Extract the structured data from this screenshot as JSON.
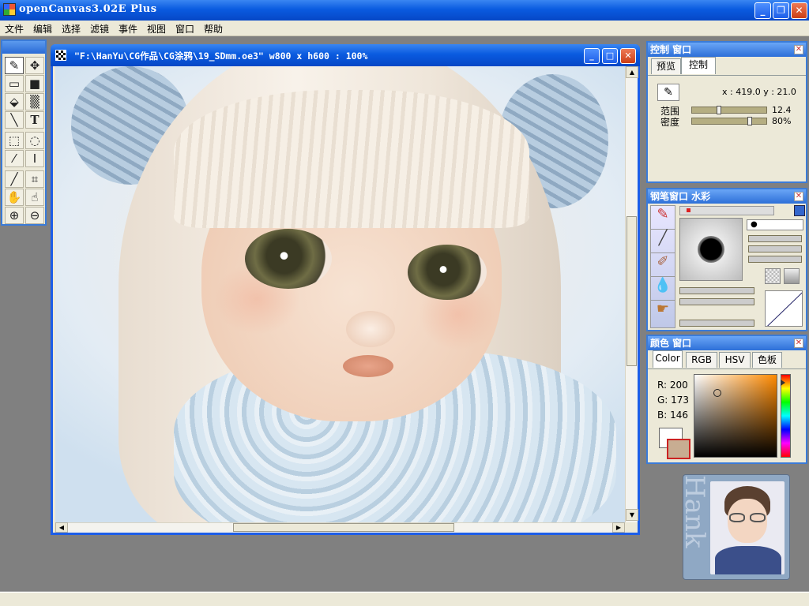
{
  "app": {
    "title": "openCanvas3.02E Plus",
    "window_buttons": [
      "_",
      "❐",
      "✕"
    ]
  },
  "menu": [
    "文件",
    "编辑",
    "选择",
    "滤镜",
    "事件",
    "视图",
    "窗口",
    "帮助"
  ],
  "tools": [
    {
      "name": "pen-tool",
      "glyph": "✎",
      "selected": true
    },
    {
      "name": "move-tool",
      "glyph": "✥"
    },
    {
      "name": "rectangle-tool",
      "glyph": "▭"
    },
    {
      "name": "fill-rect-tool",
      "glyph": "■"
    },
    {
      "name": "bucket-tool",
      "glyph": "⬙"
    },
    {
      "name": "gradient-tool",
      "glyph": "▒"
    },
    {
      "name": "line-tool",
      "glyph": "╲"
    },
    {
      "name": "text-tool",
      "glyph": "T"
    },
    {
      "name": "rect-select-tool",
      "glyph": "⬚"
    },
    {
      "name": "lasso-tool",
      "glyph": "◌"
    },
    {
      "name": "magic-wand-tool",
      "glyph": "⁄"
    },
    {
      "name": "text-select-tool",
      "glyph": "Ⅰ"
    },
    {
      "name": "eyedropper-tool",
      "glyph": "╱"
    },
    {
      "name": "crop-tool",
      "glyph": "⌗"
    },
    {
      "name": "hand-tool",
      "glyph": "✋"
    },
    {
      "name": "rotate-hand-tool",
      "glyph": "☝"
    },
    {
      "name": "zoom-in-tool",
      "glyph": "⊕"
    },
    {
      "name": "zoom-out-tool",
      "glyph": "⊖"
    }
  ],
  "document": {
    "title": "\"F:\\HanYu\\CG作品\\CG涂鸦\\19_SDmm.oe3\" w800 x h600 : 100%",
    "buttons": [
      "_",
      "□",
      "✕"
    ]
  },
  "control_panel": {
    "title": "控制 窗口",
    "tabs": [
      "预览",
      "控制"
    ],
    "active_tab": 1,
    "coords": "x : 419.0  y : 21.0",
    "labels": [
      "范围",
      "密度"
    ],
    "values": [
      "12.4",
      "80%"
    ],
    "levels": [
      0.35,
      0.8
    ]
  },
  "brush_panel": {
    "title": "钢笔窗口   水彩",
    "preview_dot": "●"
  },
  "color_panel": {
    "title": "颜色 窗口",
    "tabs": [
      "Color",
      "RGB",
      "HSV",
      "色板"
    ],
    "active_tab": 0,
    "r": "R: 200",
    "g": "G: 173",
    "b": "B: 146",
    "current_color": "#c8ad92"
  },
  "avatar": {
    "caption": "Hank"
  },
  "close_glyph": "✕"
}
